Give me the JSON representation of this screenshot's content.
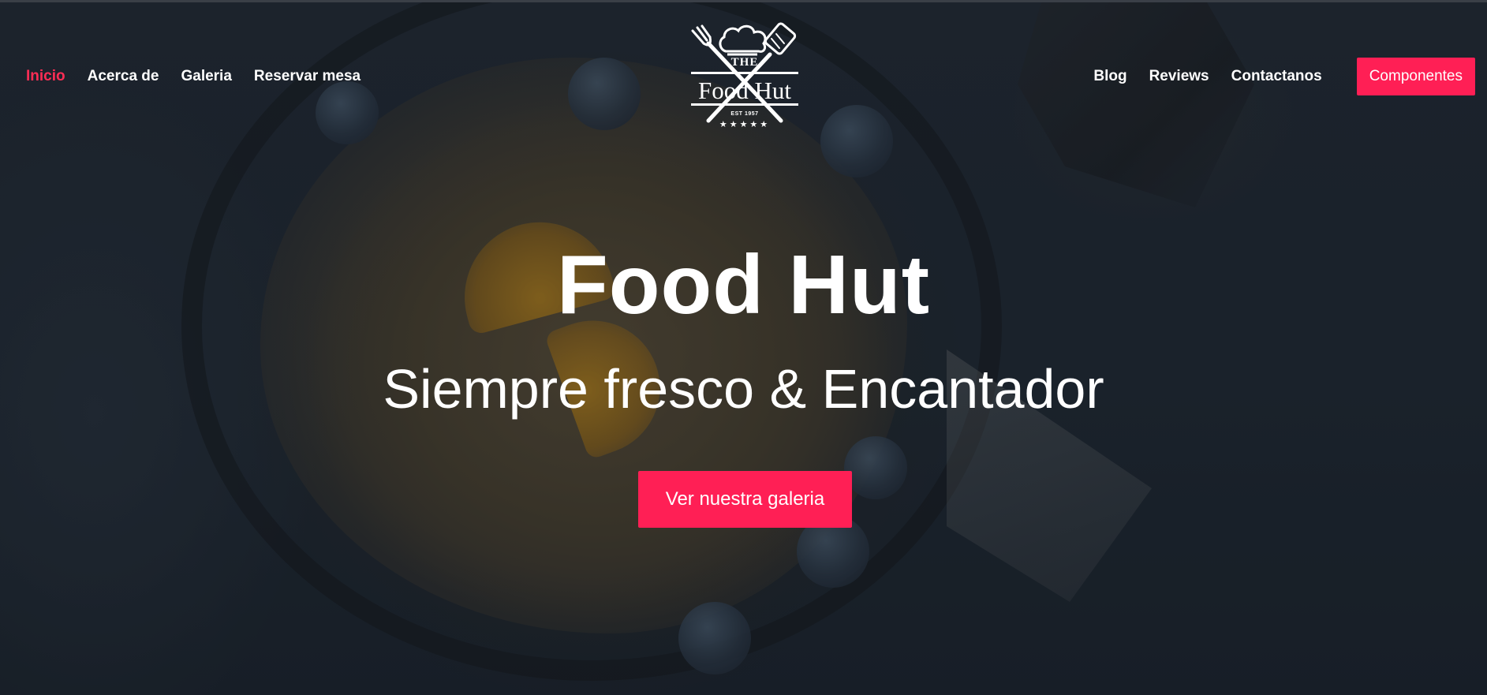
{
  "colors": {
    "accent": "#ff1f55",
    "active_link": "#ff2d55",
    "text": "#ffffff"
  },
  "nav": {
    "left_links": [
      {
        "label": "Inicio",
        "active": true
      },
      {
        "label": "Acerca de",
        "active": false
      },
      {
        "label": "Galeria",
        "active": false
      },
      {
        "label": "Reservar mesa",
        "active": false
      }
    ],
    "right_links": [
      {
        "label": "Blog"
      },
      {
        "label": "Reviews"
      },
      {
        "label": "Contactanos"
      }
    ],
    "components_button": "Componentes"
  },
  "logo": {
    "the": "THE",
    "name": "Food Hut",
    "est": "EST 1957",
    "stars": "★★★★★",
    "icons": [
      "chef-hat-icon",
      "fork-icon",
      "spatula-icon"
    ]
  },
  "hero": {
    "title": "Food Hut",
    "subtitle": "Siempre fresco & Encantador",
    "cta_label": "Ver nuestra galeria"
  }
}
